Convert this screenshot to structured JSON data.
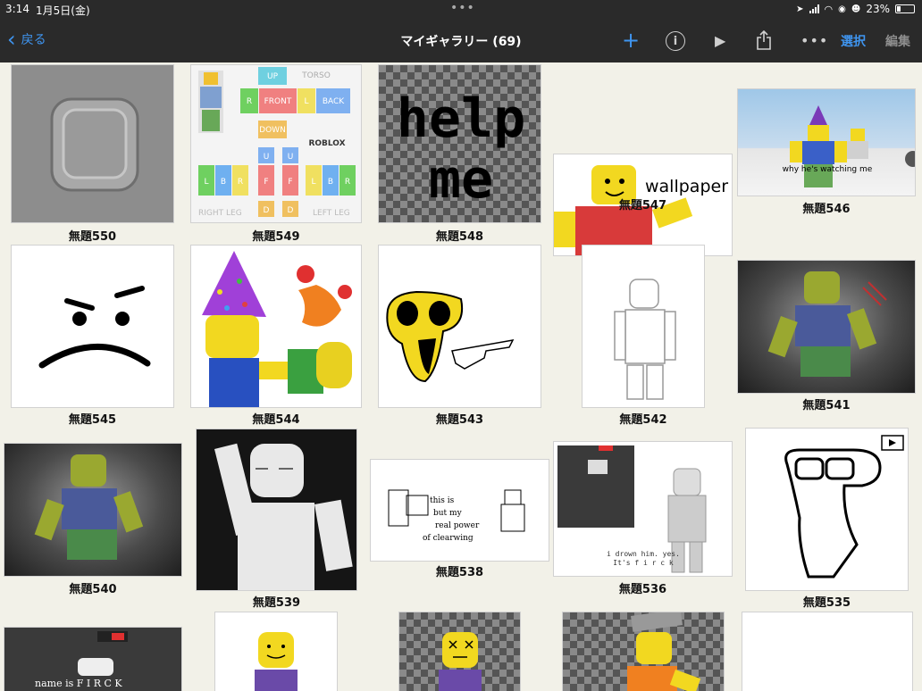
{
  "status_bar": {
    "time": "3:14",
    "date": "1月5日(金)",
    "battery": "23%"
  },
  "nav": {
    "back_label": "戻る",
    "title": "マイギャラリー (69)",
    "select_label": "選択",
    "edit_label": "編集"
  },
  "gallery": {
    "items": [
      {
        "title": "無題550"
      },
      {
        "title": "無題549",
        "art_text": [
          "UP",
          "TORSO",
          "R",
          "FRONT",
          "L",
          "BACK",
          "DOWN",
          "ROBLOX",
          "U",
          "U",
          "L",
          "B",
          "R",
          "F",
          "F",
          "L",
          "B",
          "R",
          "D",
          "D",
          "RIGHT LEG",
          "LEFT LEG"
        ]
      },
      {
        "title": "無題548",
        "art_text": [
          "help",
          "me"
        ]
      },
      {
        "title": "無題547",
        "art_text": [
          "wallpaper"
        ]
      },
      {
        "title": "無題546",
        "art_text": [
          "why he's watching me"
        ]
      },
      {
        "title": "無題545"
      },
      {
        "title": "無題544"
      },
      {
        "title": "無題543"
      },
      {
        "title": "無題542"
      },
      {
        "title": "無題541"
      },
      {
        "title": "無題540"
      },
      {
        "title": "無題539"
      },
      {
        "title": "無題538",
        "art_text": [
          "this is",
          "but my",
          "real power",
          "of clearwing"
        ]
      },
      {
        "title": "無題536",
        "art_text": [
          "i drown him. yes.",
          "It's f i r c k"
        ]
      },
      {
        "title": "無題535"
      },
      {
        "title": "",
        "art_text": [
          "name is F I R C K"
        ]
      },
      {
        "title": ""
      },
      {
        "title": ""
      },
      {
        "title": ""
      },
      {
        "title": ""
      }
    ]
  }
}
